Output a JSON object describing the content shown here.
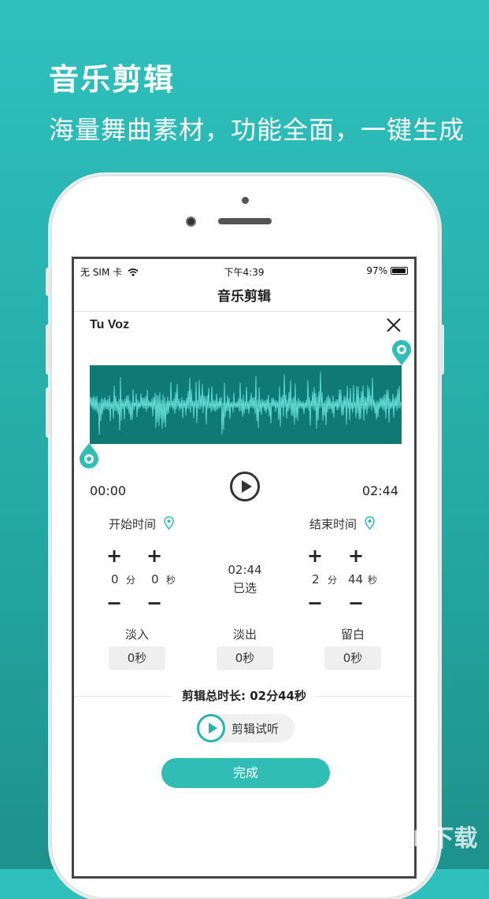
{
  "promo": {
    "title": "音乐剪辑",
    "subtitle": "海量舞曲素材，功能全面，一键生成"
  },
  "status_bar": {
    "carrier": "无 SIM 卡",
    "time": "下午4:39",
    "battery": "97%"
  },
  "nav": {
    "title": "音乐剪辑"
  },
  "track": {
    "title": "Tu Voz",
    "start_time": "00:00",
    "end_time": "02:44"
  },
  "start_section": {
    "label": "开始时间",
    "minutes": "0",
    "minute_unit": "分",
    "seconds": "0",
    "second_unit": "秒"
  },
  "end_section": {
    "label": "结束时间",
    "minutes": "2",
    "minute_unit": "分",
    "seconds": "44",
    "second_unit": "秒"
  },
  "selection": {
    "duration": "02:44",
    "label": "已选"
  },
  "steppers": {
    "plus": "+",
    "minus": "−"
  },
  "fade": {
    "fade_in": {
      "label": "淡入",
      "value": "0秒"
    },
    "fade_out": {
      "label": "淡出",
      "value": "0秒"
    },
    "blank": {
      "label": "留白",
      "value": "0秒"
    }
  },
  "summary": {
    "text": "剪辑总时长: 02分44秒"
  },
  "actions": {
    "preview_label": "剪辑试听",
    "done_label": "完成"
  },
  "watermark": "KK下载",
  "colors": {
    "accent": "#2fbdb5",
    "waveform_bg": "#0e7a73",
    "waveform_line": "#6ee8e0"
  },
  "icons": [
    "wifi-icon",
    "battery-icon",
    "close-icon",
    "map-pin-icon",
    "play-icon"
  ]
}
